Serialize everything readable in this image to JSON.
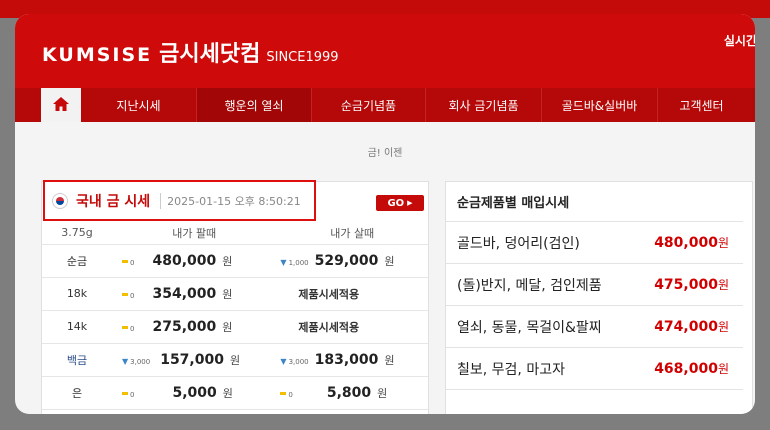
{
  "header": {
    "brand": "KUMSISE",
    "korean_name": "금시세닷컴",
    "since": "SINCE1999",
    "realtime_label": "실시간"
  },
  "nav": {
    "home_icon": "home-icon",
    "items": [
      "지난시세",
      "행운의 열쇠",
      "순금기념품",
      "회사 금기념품",
      "골드바&실버바",
      "고객센터"
    ]
  },
  "breadcrumb": "금! 이젠",
  "domestic": {
    "title": "국내 금 시세",
    "datetime": "2025-01-15 오후 8:50:21",
    "go_label": "GO",
    "headers": {
      "unit": "3.75g",
      "sell": "내가 팔때",
      "buy": "내가 살때"
    },
    "rows": [
      {
        "metal": "순금",
        "sell_change": "0",
        "sell": "480,000",
        "sell_unit": "원",
        "buy_change": "1,000",
        "buy": "529,000",
        "buy_unit": "원"
      },
      {
        "metal": "18k",
        "sell_change": "0",
        "sell": "354,000",
        "sell_unit": "원",
        "buy_text": "제품시세적용"
      },
      {
        "metal": "14k",
        "sell_change": "0",
        "sell": "275,000",
        "sell_unit": "원",
        "buy_text": "제품시세적용"
      },
      {
        "metal": "백금",
        "sell_change": "3,000",
        "sell": "157,000",
        "sell_unit": "원",
        "buy_change": "3,000",
        "buy": "183,000",
        "buy_unit": "원"
      },
      {
        "metal": "은",
        "sell_change": "0",
        "sell": "5,000",
        "sell_unit": "원",
        "buy_change": "0",
        "buy": "5,800",
        "buy_unit": "원"
      }
    ]
  },
  "purchase": {
    "title": "순금제품별 매입시세",
    "rows": [
      {
        "label": "골드바, 덩어리(검인)",
        "price": "480,000",
        "unit": "원"
      },
      {
        "label": "(돌)반지, 메달, 검인제품",
        "price": "475,000",
        "unit": "원"
      },
      {
        "label": "열쇠, 동물, 목걸이&팔찌",
        "price": "474,000",
        "unit": "원"
      },
      {
        "label": "칠보, 무검, 마고자",
        "price": "468,000",
        "unit": "원"
      }
    ]
  },
  "colors": {
    "brand_red": "#cf0a0a",
    "price_red": "#d10000",
    "down_blue": "#3c85c9",
    "flat_yellow": "#f0c000"
  }
}
